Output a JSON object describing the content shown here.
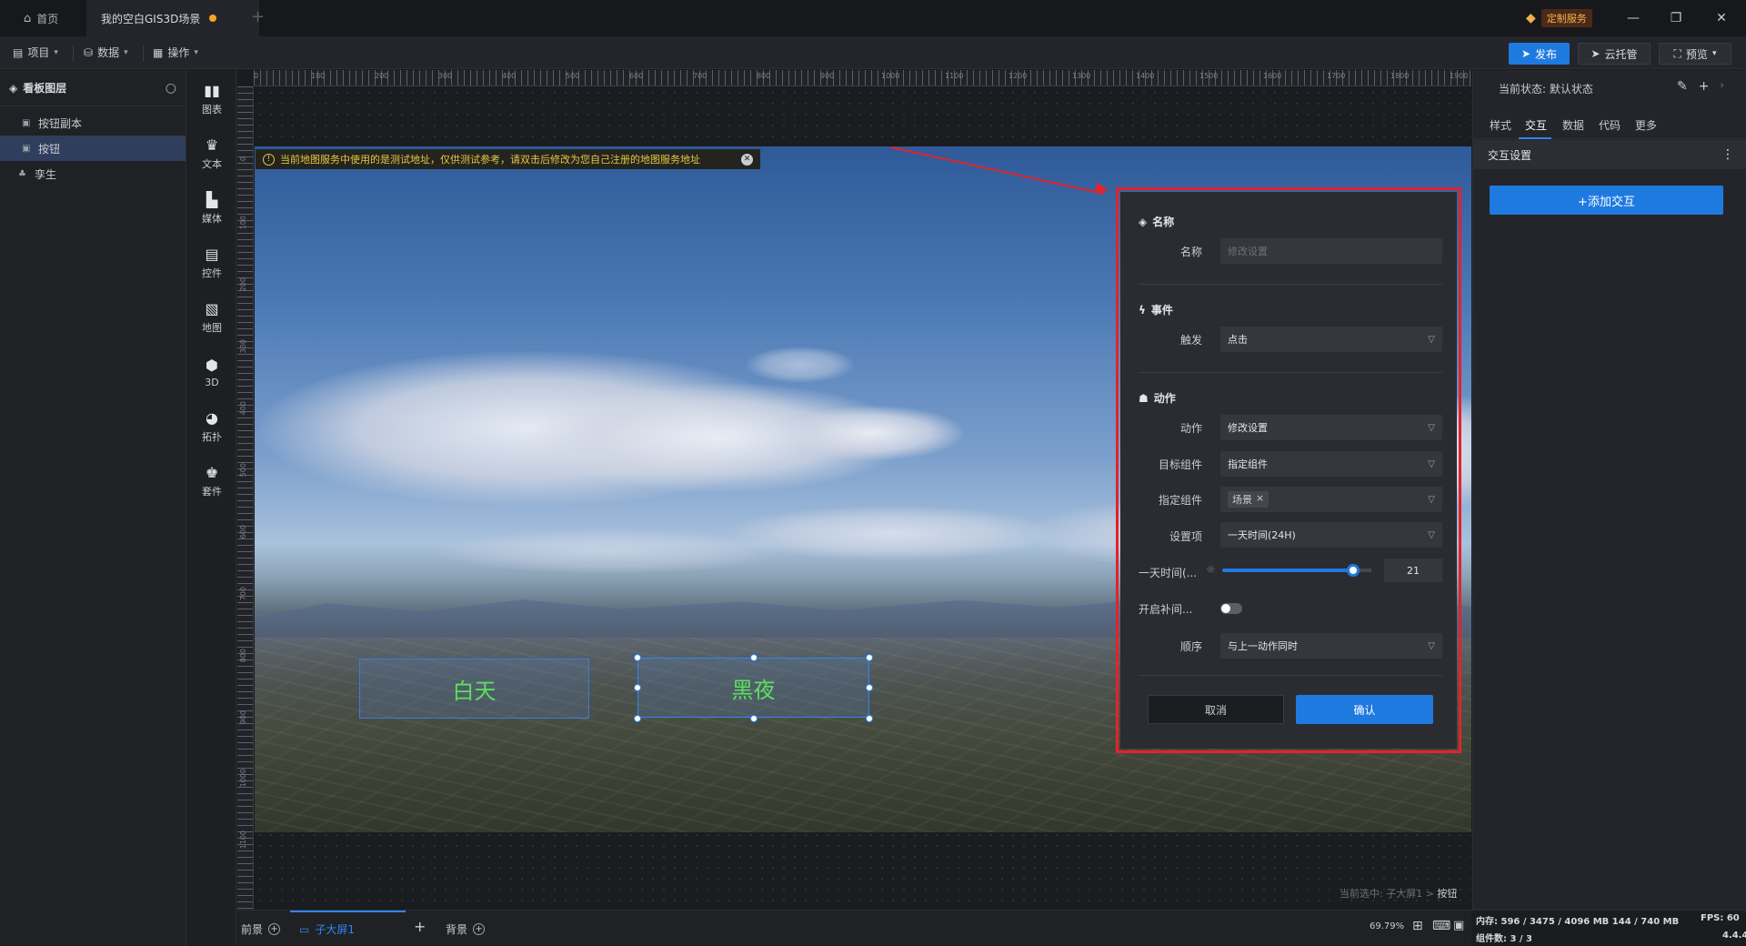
{
  "titlebar": {
    "home_tab": "首页",
    "active_tab": "我的空白GIS3D场景",
    "custom_service": "定制服务"
  },
  "menubar": {
    "project": "项目",
    "data": "数据",
    "operate": "操作",
    "publish": "发布",
    "cloud": "云托管",
    "preview": "预览"
  },
  "layers": {
    "title": "看板图层",
    "items": [
      {
        "label": "按钮副本"
      },
      {
        "label": "按钮"
      },
      {
        "label": "孪生"
      }
    ]
  },
  "components": [
    {
      "label": "图表",
      "icon": "chart-icon"
    },
    {
      "label": "文本",
      "icon": "text-icon"
    },
    {
      "label": "媒体",
      "icon": "media-icon"
    },
    {
      "label": "控件",
      "icon": "control-icon"
    },
    {
      "label": "地图",
      "icon": "map-icon"
    },
    {
      "label": "3D",
      "icon": "cube-icon"
    },
    {
      "label": "拓扑",
      "icon": "topology-icon"
    },
    {
      "label": "套件",
      "icon": "suite-icon"
    }
  ],
  "ruler": {
    "top": [
      "0",
      "100",
      "200",
      "300",
      "400",
      "500",
      "600",
      "700",
      "800",
      "900",
      "1000",
      "1100",
      "1200",
      "1300",
      "1400",
      "1500",
      "1600",
      "1700",
      "1800",
      "1900"
    ],
    "left": [
      "0",
      "100",
      "200",
      "300",
      "400",
      "500",
      "600",
      "700",
      "800",
      "900",
      "1000",
      "1100"
    ]
  },
  "canvas": {
    "warning": "当前地图服务中使用的是测试地址，仅供测试参考，请双击后修改为您自己注册的地图服务地址",
    "button_day": "白天",
    "button_night": "黑夜",
    "selection": "当前选中: 子大屏1 >",
    "selection_target": "按钮"
  },
  "dialog": {
    "name_section": "名称",
    "name_label": "名称",
    "name_placeholder": "修改设置",
    "event_section": "事件",
    "trigger_label": "触发",
    "trigger_value": "点击",
    "action_section": "动作",
    "action_label": "动作",
    "action_value": "修改设置",
    "target_label": "目标组件",
    "target_value": "指定组件",
    "specify_label": "指定组件",
    "specify_tag": "场景",
    "setting_label": "设置项",
    "setting_value": "一天时间(24H)",
    "time_label": "一天时间(...",
    "time_value": "21",
    "time_fraction": 0.875,
    "tween_label": "开启补间...",
    "tween_on": false,
    "order_label": "顺序",
    "order_value": "与上一动作同时",
    "cancel": "取消",
    "confirm": "确认"
  },
  "bottombar": {
    "foreground": "前景",
    "screen1": "子大屏1",
    "background": "背景",
    "zoom": "69.79%"
  },
  "rpanel": {
    "state": "当前状态:  默认状态",
    "tabs": [
      "样式",
      "交互",
      "数据",
      "代码",
      "更多"
    ],
    "active_tab": "交互",
    "section": "交互设置",
    "add_button": "+添加交互"
  },
  "statusbar": {
    "memory": "内存:  596 / 3475 / 4096 MB  144 / 740 MB",
    "fps": "FPS:  60",
    "components": "组件数: 3 / 3",
    "version": "4.4.4"
  },
  "colors": {
    "accent": "#1f7ae0",
    "highlight_frame": "#e5222a",
    "button_text": "#5ce05c",
    "warning": "#e8c547"
  }
}
